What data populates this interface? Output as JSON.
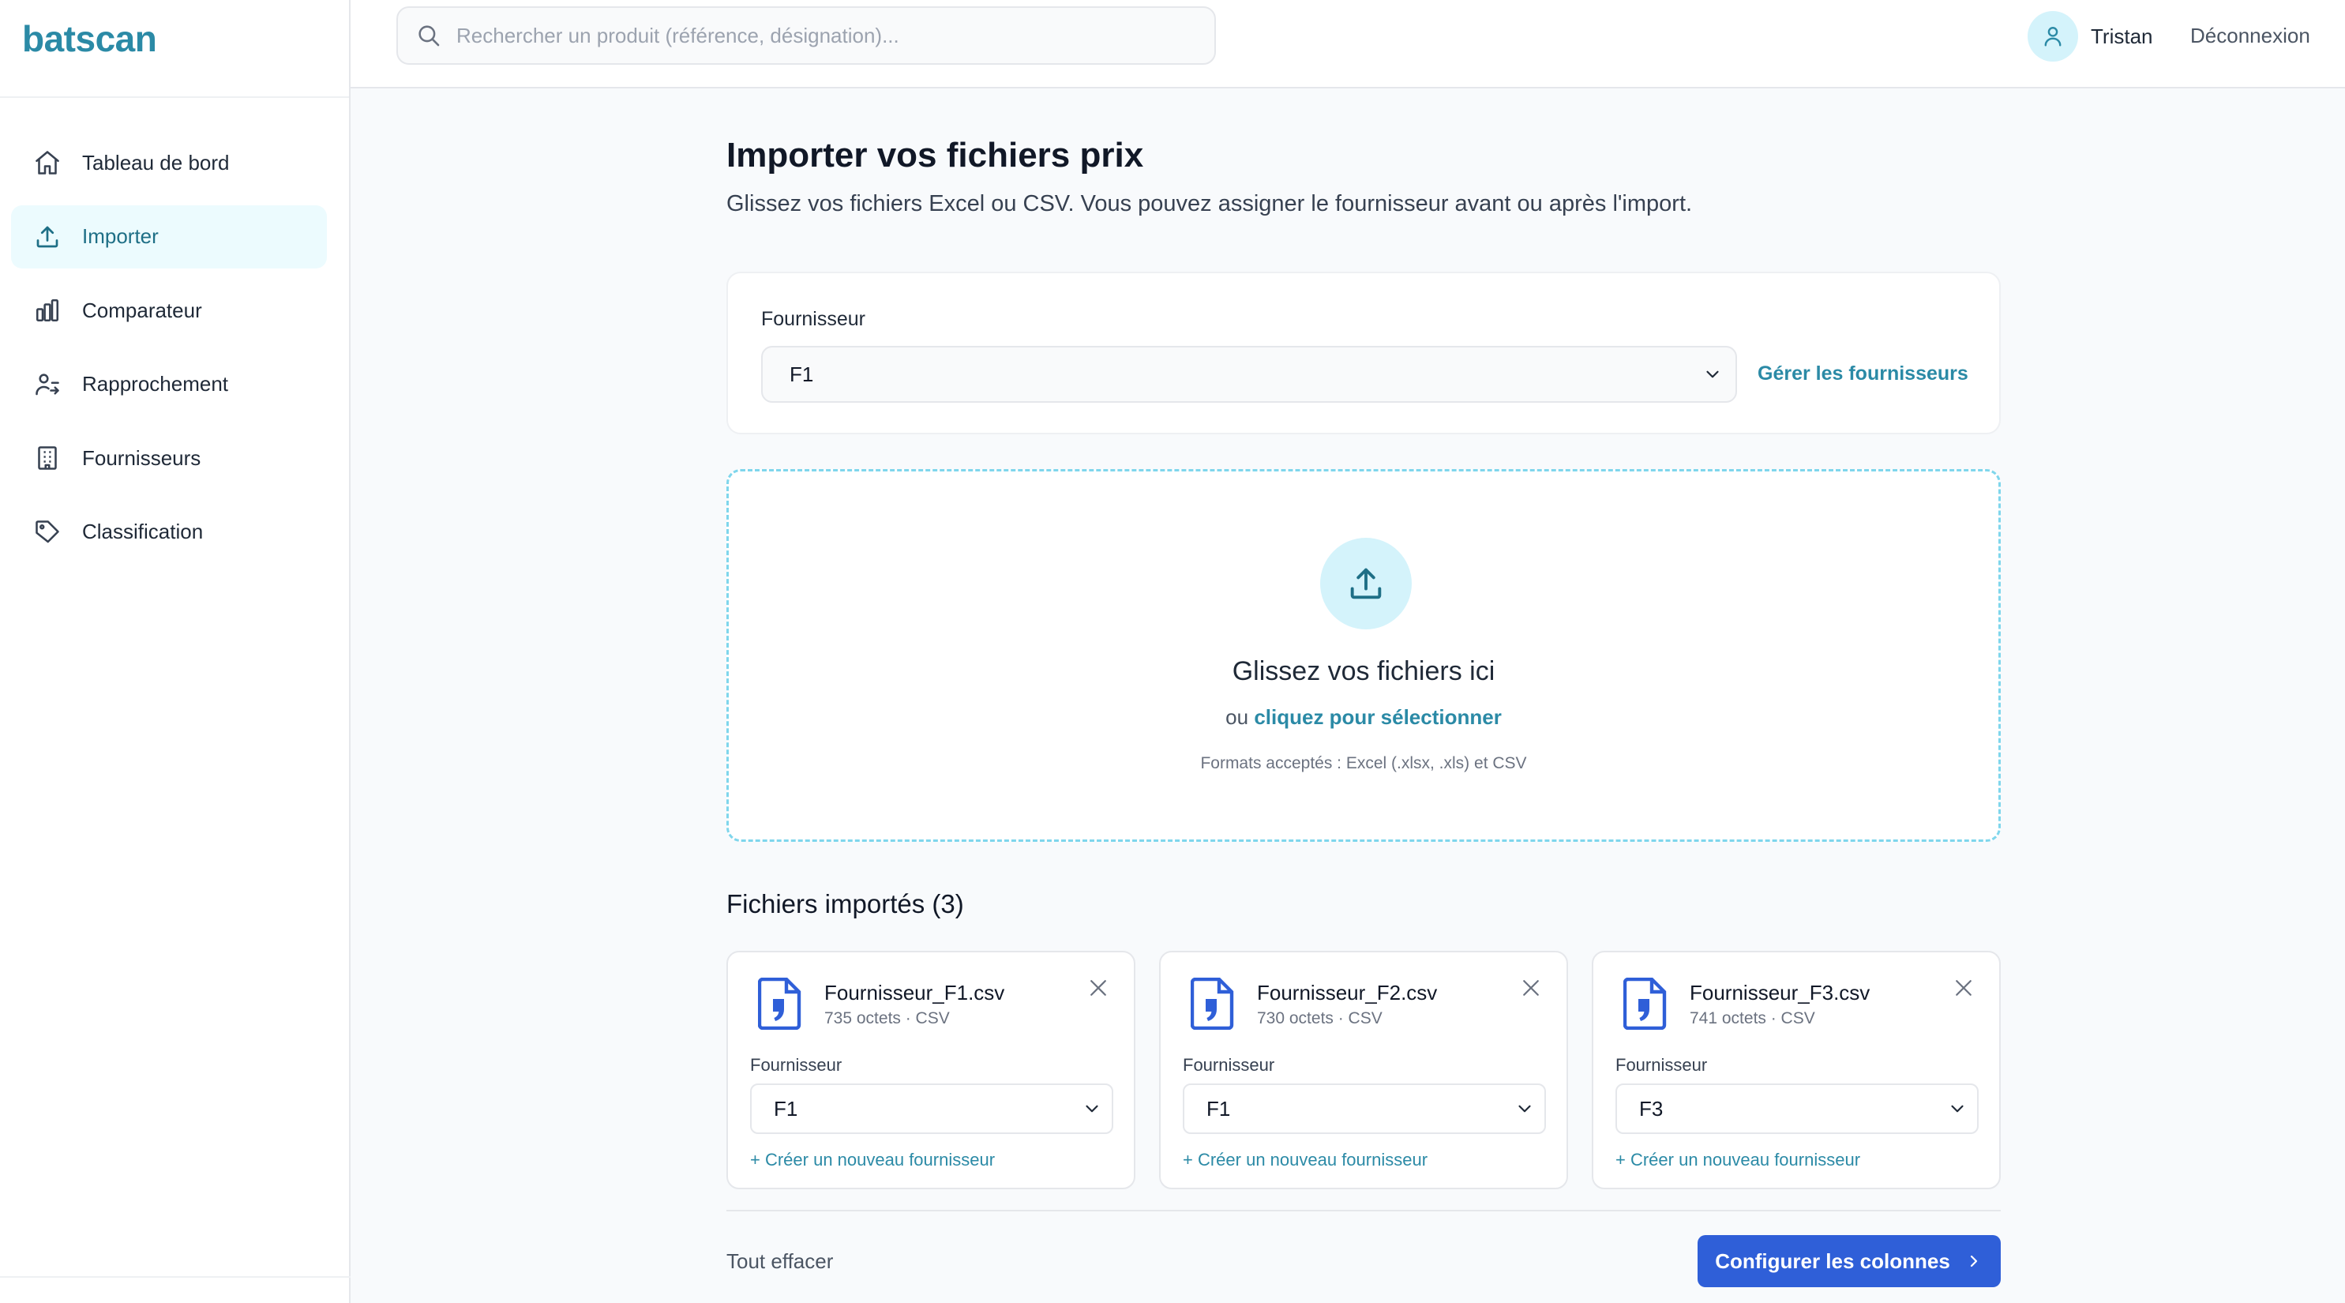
{
  "app": {
    "brand": "batscan"
  },
  "sidebar": {
    "items": [
      {
        "label": "Tableau de bord",
        "icon": "home-icon",
        "active": false
      },
      {
        "label": "Importer",
        "icon": "upload-icon",
        "active": true
      },
      {
        "label": "Comparateur",
        "icon": "bar-chart-icon",
        "active": false
      },
      {
        "label": "Rapprochement",
        "icon": "reconcile-icon",
        "active": false
      },
      {
        "label": "Fournisseurs",
        "icon": "building-icon",
        "active": false
      },
      {
        "label": "Classification",
        "icon": "tag-icon",
        "active": false
      }
    ]
  },
  "topbar": {
    "search_placeholder": "Rechercher un produit (référence, désignation)...",
    "user_name": "Tristan",
    "logout_label": "Déconnexion"
  },
  "main": {
    "title": "Importer vos fichiers prix",
    "subtitle": "Glissez vos fichiers Excel ou CSV. Vous pouvez assigner le fournisseur avant ou après l'import.",
    "supplier": {
      "label": "Fournisseur",
      "selected": "F1",
      "manage_link": "Gérer les fournisseurs"
    },
    "dropzone": {
      "title": "Glissez vos fichiers ici",
      "prefix": "ou",
      "link": "cliquez pour sélectionner",
      "formats": "Formats acceptés : Excel (.xlsx, .xls) et CSV"
    },
    "files_title": "Fichiers importés (3)",
    "files": [
      {
        "name": "Fournisseur_F1.csv",
        "meta": "735 octets · CSV",
        "supplier_label": "Fournisseur",
        "supplier": "F1",
        "create_link": "+ Créer un nouveau fournisseur"
      },
      {
        "name": "Fournisseur_F2.csv",
        "meta": "730 octets · CSV",
        "supplier_label": "Fournisseur",
        "supplier": "F1",
        "create_link": "+ Créer un nouveau fournisseur"
      },
      {
        "name": "Fournisseur_F3.csv",
        "meta": "741 octets · CSV",
        "supplier_label": "Fournisseur",
        "supplier": "F3",
        "create_link": "+ Créer un nouveau fournisseur"
      }
    ],
    "clear_all": "Tout effacer",
    "configure_button": "Configurer les colonnes"
  },
  "colors": {
    "accent": "#2b8aa6",
    "accent_light": "#d4f3fb",
    "primary_button": "#2f5fd8",
    "file_icon": "#2f5fd8",
    "dropzone_border": "#7fd6ec"
  }
}
